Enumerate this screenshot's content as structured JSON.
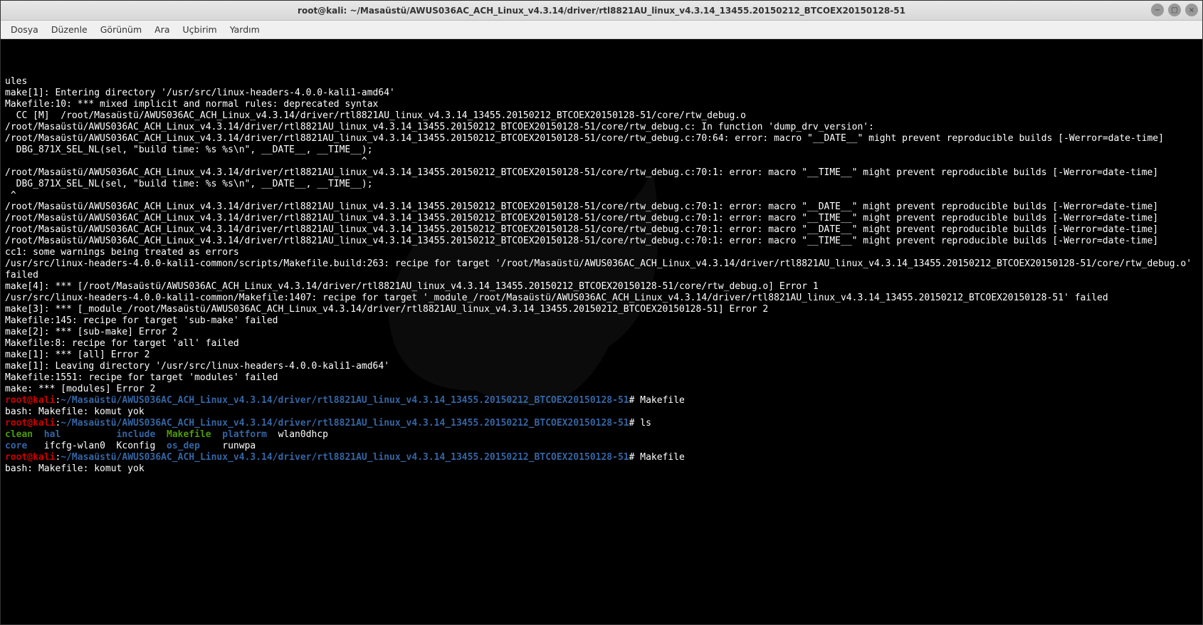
{
  "window": {
    "title": "root@kali: ~/Masaüstü/AWUS036AC_ACH_Linux_v4.3.14/driver/rtl8821AU_linux_v4.3.14_13455.20150212_BTCOEX20150128-51"
  },
  "menubar": {
    "items": [
      "Dosya",
      "Düzenle",
      "Görünüm",
      "Ara",
      "Uçbirim",
      "Yardım"
    ]
  },
  "terminal": {
    "lines": [
      {
        "t": "plain",
        "text": "ules"
      },
      {
        "t": "plain",
        "text": "make[1]: Entering directory '/usr/src/linux-headers-4.0.0-kali1-amd64'"
      },
      {
        "t": "plain",
        "text": "Makefile:10: *** mixed implicit and normal rules: deprecated syntax"
      },
      {
        "t": "plain",
        "text": "  CC [M]  /root/Masaüstü/AWUS036AC_ACH_Linux_v4.3.14/driver/rtl8821AU_linux_v4.3.14_13455.20150212_BTCOEX20150128-51/core/rtw_debug.o"
      },
      {
        "t": "plain",
        "text": "/root/Masaüstü/AWUS036AC_ACH_Linux_v4.3.14/driver/rtl8821AU_linux_v4.3.14_13455.20150212_BTCOEX20150128-51/core/rtw_debug.c: In function 'dump_drv_version':"
      },
      {
        "t": "plain",
        "text": "/root/Masaüstü/AWUS036AC_ACH_Linux_v4.3.14/driver/rtl8821AU_linux_v4.3.14_13455.20150212_BTCOEX20150128-51/core/rtw_debug.c:70:64: error: macro \"__DATE__\" might prevent reproducible builds [-Werror=date-time]"
      },
      {
        "t": "plain",
        "text": "  DBG_871X_SEL_NL(sel, \"build time: %s %s\\n\", __DATE__, __TIME__);"
      },
      {
        "t": "plain",
        "text": "                                                                ^"
      },
      {
        "t": "plain",
        "text": "/root/Masaüstü/AWUS036AC_ACH_Linux_v4.3.14/driver/rtl8821AU_linux_v4.3.14_13455.20150212_BTCOEX20150128-51/core/rtw_debug.c:70:1: error: macro \"__TIME__\" might prevent reproducible builds [-Werror=date-time]"
      },
      {
        "t": "plain",
        "text": "  DBG_871X_SEL_NL(sel, \"build time: %s %s\\n\", __DATE__, __TIME__);"
      },
      {
        "t": "plain",
        "text": " ^"
      },
      {
        "t": "plain",
        "text": "/root/Masaüstü/AWUS036AC_ACH_Linux_v4.3.14/driver/rtl8821AU_linux_v4.3.14_13455.20150212_BTCOEX20150128-51/core/rtw_debug.c:70:1: error: macro \"__DATE__\" might prevent reproducible builds [-Werror=date-time]"
      },
      {
        "t": "plain",
        "text": "/root/Masaüstü/AWUS036AC_ACH_Linux_v4.3.14/driver/rtl8821AU_linux_v4.3.14_13455.20150212_BTCOEX20150128-51/core/rtw_debug.c:70:1: error: macro \"__TIME__\" might prevent reproducible builds [-Werror=date-time]"
      },
      {
        "t": "plain",
        "text": "/root/Masaüstü/AWUS036AC_ACH_Linux_v4.3.14/driver/rtl8821AU_linux_v4.3.14_13455.20150212_BTCOEX20150128-51/core/rtw_debug.c:70:1: error: macro \"__DATE__\" might prevent reproducible builds [-Werror=date-time]"
      },
      {
        "t": "plain",
        "text": "/root/Masaüstü/AWUS036AC_ACH_Linux_v4.3.14/driver/rtl8821AU_linux_v4.3.14_13455.20150212_BTCOEX20150128-51/core/rtw_debug.c:70:1: error: macro \"__TIME__\" might prevent reproducible builds [-Werror=date-time]"
      },
      {
        "t": "plain",
        "text": "cc1: some warnings being treated as errors"
      },
      {
        "t": "plain",
        "text": "/usr/src/linux-headers-4.0.0-kali1-common/scripts/Makefile.build:263: recipe for target '/root/Masaüstü/AWUS036AC_ACH_Linux_v4.3.14/driver/rtl8821AU_linux_v4.3.14_13455.20150212_BTCOEX20150128-51/core/rtw_debug.o' failed"
      },
      {
        "t": "plain",
        "text": "make[4]: *** [/root/Masaüstü/AWUS036AC_ACH_Linux_v4.3.14/driver/rtl8821AU_linux_v4.3.14_13455.20150212_BTCOEX20150128-51/core/rtw_debug.o] Error 1"
      },
      {
        "t": "plain",
        "text": "/usr/src/linux-headers-4.0.0-kali1-common/Makefile:1407: recipe for target '_module_/root/Masaüstü/AWUS036AC_ACH_Linux_v4.3.14/driver/rtl8821AU_linux_v4.3.14_13455.20150212_BTCOEX20150128-51' failed"
      },
      {
        "t": "plain",
        "text": "make[3]: *** [_module_/root/Masaüstü/AWUS036AC_ACH_Linux_v4.3.14/driver/rtl8821AU_linux_v4.3.14_13455.20150212_BTCOEX20150128-51] Error 2"
      },
      {
        "t": "plain",
        "text": "Makefile:145: recipe for target 'sub-make' failed"
      },
      {
        "t": "plain",
        "text": "make[2]: *** [sub-make] Error 2"
      },
      {
        "t": "plain",
        "text": "Makefile:8: recipe for target 'all' failed"
      },
      {
        "t": "plain",
        "text": "make[1]: *** [all] Error 2"
      },
      {
        "t": "plain",
        "text": "make[1]: Leaving directory '/usr/src/linux-headers-4.0.0-kali1-amd64'"
      },
      {
        "t": "plain",
        "text": "Makefile:1551: recipe for target 'modules' failed"
      },
      {
        "t": "plain",
        "text": "make: *** [modules] Error 2"
      }
    ],
    "prompt": {
      "user": "root",
      "host": "kali",
      "path": "~/Masaüstü/AWUS036AC_ACH_Linux_v4.3.14/driver/rtl8821AU_linux_v4.3.14_13455.20150212_BTCOEX20150128-51",
      "symbol": "#"
    },
    "commands": [
      {
        "cmd": "Makefile",
        "response": [
          "bash: Makefile: komut yok"
        ]
      },
      {
        "cmd": "ls",
        "response_ls": true
      },
      {
        "cmd": "Makefile",
        "response": [
          "bash: Makefile: komut yok"
        ]
      }
    ],
    "ls_output": {
      "row1": [
        {
          "name": "clean",
          "cls": "exec"
        },
        {
          "name": "hal",
          "cls": "dir"
        },
        {
          "name": "include",
          "cls": "dir"
        },
        {
          "name": "Makefile",
          "cls": "exec"
        },
        {
          "name": "platform",
          "cls": "dir"
        },
        {
          "name": "wlan0dhcp",
          "cls": "plain"
        }
      ],
      "row2": [
        {
          "name": "core",
          "cls": "dir"
        },
        {
          "name": "ifcfg-wlan0",
          "cls": "plain"
        },
        {
          "name": "Kconfig",
          "cls": "plain"
        },
        {
          "name": "os_dep",
          "cls": "dir"
        },
        {
          "name": "runwpa",
          "cls": "plain"
        }
      ]
    }
  }
}
